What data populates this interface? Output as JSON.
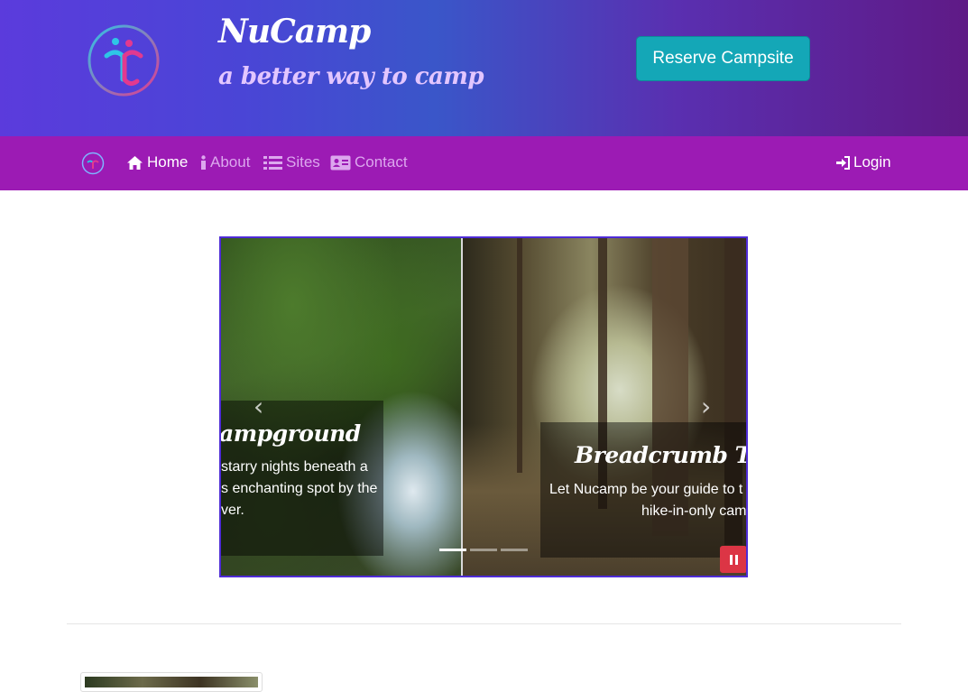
{
  "header": {
    "title": "NuCamp",
    "subtitle": "a better way to camp",
    "reserve_label": "Reserve Campsite"
  },
  "nav": {
    "items": [
      {
        "label": "Home",
        "icon": "home-icon",
        "active": true
      },
      {
        "label": "About",
        "icon": "info-icon",
        "active": false
      },
      {
        "label": "Sites",
        "icon": "list-icon",
        "active": false
      },
      {
        "label": "Contact",
        "icon": "address-card-icon",
        "active": false
      }
    ],
    "login_label": "Login"
  },
  "carousel": {
    "slides": [
      {
        "title": "ampground",
        "text_lines": [
          "starry nights beneath a",
          "s enchanting spot by the",
          "ver."
        ]
      },
      {
        "title": "Breadcrumb Trail",
        "text_lines": [
          "Let Nucamp be your guide to t",
          "hike-in-only cam"
        ]
      }
    ],
    "indicators": 3,
    "active_indicator": 0,
    "prev_glyph": "‹",
    "next_glyph": "›"
  },
  "colors": {
    "navbar": "#9c1bb4",
    "reserve_button": "#14a7b7",
    "pause_button": "#dc3545",
    "carousel_border": "#4e2bd6"
  }
}
